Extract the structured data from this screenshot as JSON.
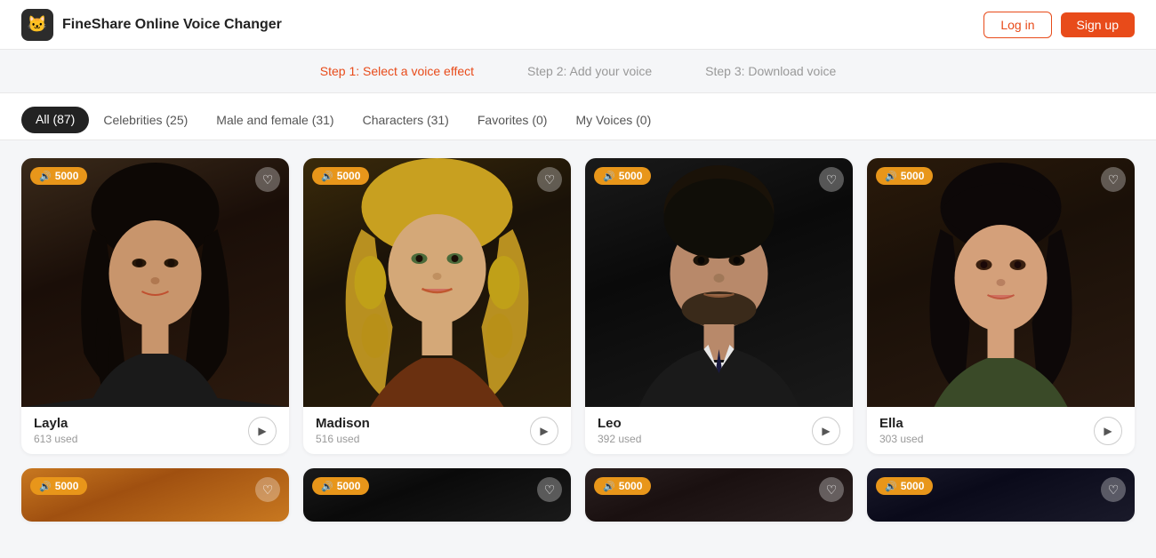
{
  "header": {
    "logo_text": "🐱",
    "title": "FineShare Online Voice Changer",
    "login_label": "Log in",
    "signup_label": "Sign up"
  },
  "steps": [
    {
      "id": "step1",
      "label": "Step 1: Select a voice effect",
      "active": true
    },
    {
      "id": "step2",
      "label": "Step 2: Add your voice",
      "active": false
    },
    {
      "id": "step3",
      "label": "Step 3: Download voice",
      "active": false
    }
  ],
  "tabs": [
    {
      "id": "all",
      "label": "All (87)",
      "active": true
    },
    {
      "id": "celebrities",
      "label": "Celebrities (25)",
      "active": false
    },
    {
      "id": "male-female",
      "label": "Male and female (31)",
      "active": false
    },
    {
      "id": "characters",
      "label": "Characters (31)",
      "active": false
    },
    {
      "id": "favorites",
      "label": "Favorites (0)",
      "active": false
    },
    {
      "id": "my-voices",
      "label": "My Voices (0)",
      "active": false
    }
  ],
  "cards": [
    {
      "id": "layla",
      "name": "Layla",
      "used": "613 used",
      "badge": "5000",
      "image_class": "card-img-layla"
    },
    {
      "id": "madison",
      "name": "Madison",
      "used": "516 used",
      "badge": "5000",
      "image_class": "card-img-madison"
    },
    {
      "id": "leo",
      "name": "Leo",
      "used": "392 used",
      "badge": "5000",
      "image_class": "card-img-leo"
    },
    {
      "id": "ella",
      "name": "Ella",
      "used": "303 used",
      "badge": "5000",
      "image_class": "card-img-ella"
    }
  ],
  "cards_row2": [
    {
      "id": "row2-1",
      "badge": "5000",
      "image_class": "card-img-row2-1"
    },
    {
      "id": "row2-2",
      "badge": "5000",
      "image_class": "card-img-row2-2"
    },
    {
      "id": "row2-3",
      "badge": "5000",
      "image_class": "card-img-row2-3"
    },
    {
      "id": "row2-4",
      "badge": "5000",
      "image_class": "card-img-row2-4"
    }
  ],
  "badge_coin": "🔊",
  "colors": {
    "active_step": "#e84b1a",
    "badge_bg": "#e8961a",
    "active_tab_bg": "#222"
  }
}
